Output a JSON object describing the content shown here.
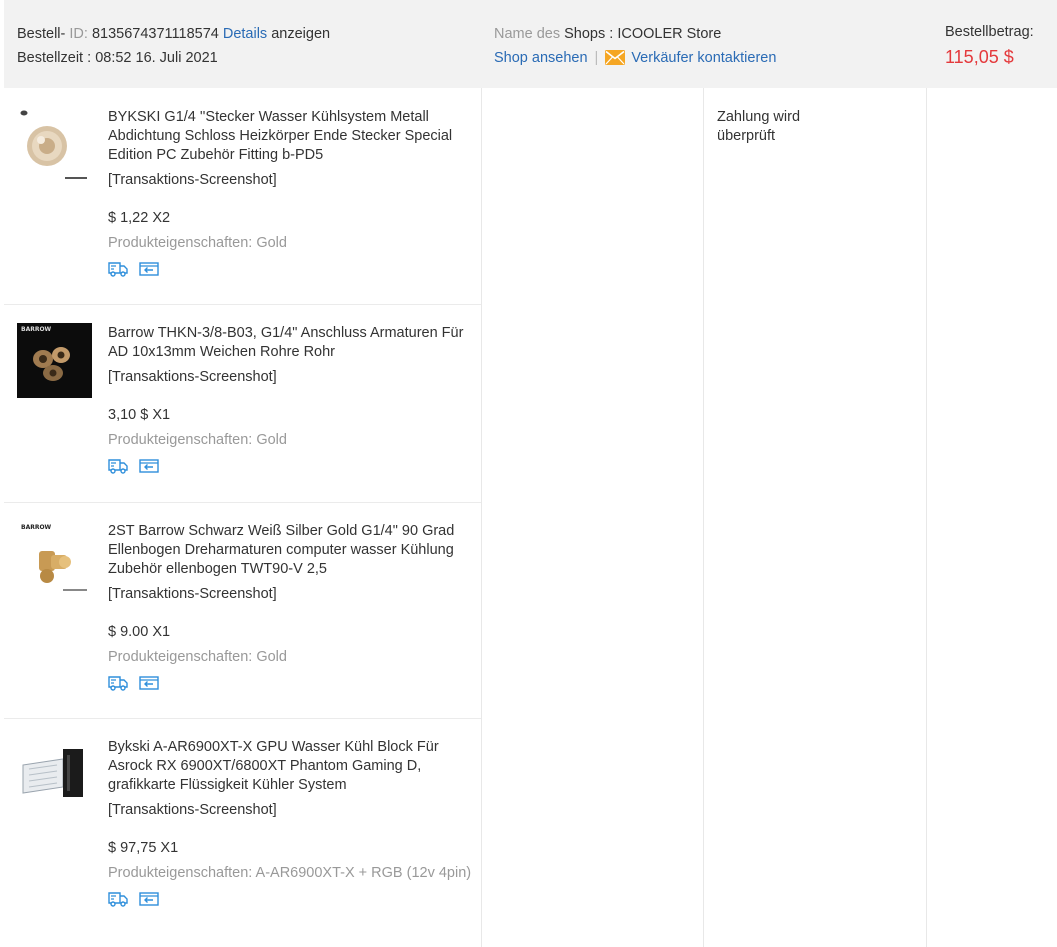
{
  "order": {
    "id_prefix": "Bestell-",
    "id_label": "ID:",
    "id_value": "8135674371118574",
    "details_link": "Details",
    "details_suffix": "anzeigen",
    "time_label": "Bestellzeit :",
    "time_value": "08:52 16. Juli 2021"
  },
  "shop": {
    "name_label_muted": "Name des",
    "name_label": "Shops :",
    "name_value": "ICOOLER Store",
    "view_link": "Shop ansehen",
    "separator": "|",
    "contact_link": "Verkäufer kontaktieren"
  },
  "total": {
    "label": "Bestellbetrag:",
    "value": "115,05 $"
  },
  "status": {
    "line1": "Zahlung wird",
    "line2": "überprüft"
  },
  "colors": {
    "link": "#2a6bb5",
    "price_accent": "#e4393c",
    "header_bg": "#f2f2f2",
    "icon_blue": "#2f8fdb",
    "mail_orange": "#f5a623"
  },
  "items": [
    {
      "title": "BYKSKI G1/4 ''Stecker Wasser Kühlsystem Metall Abdichtung Schloss Heizkörper Ende Stecker Special Edition PC Zubehör Fitting b-PD5",
      "snapshot": "[Transaktions-Screenshot]",
      "price": "$ 1,22 X2",
      "props": "Produkteigenschaften: Gold"
    },
    {
      "title": "Barrow THKN-3/8-B03, G1/4\" Anschluss Armaturen Für AD 10x13mm Weichen Rohre Rohr",
      "snapshot": "[Transaktions-Screenshot]",
      "price": "3,10 $ X1",
      "props": "Produkteigenschaften: Gold",
      "thumb_label": "BARROW"
    },
    {
      "title": "2ST Barrow Schwarz Weiß Silber Gold G1/4\" 90 Grad Ellenbogen Dreharmaturen computer wasser Kühlung Zubehör ellenbogen TWT90-V 2,5",
      "snapshot": "[Transaktions-Screenshot]",
      "price": "$ 9.00 X1",
      "props": "Produkteigenschaften: Gold",
      "thumb_label": "BARROW"
    },
    {
      "title": "Bykski A-AR6900XT-X GPU Wasser Kühl Block Für Asrock RX 6900XT/6800XT Phantom Gaming D, grafikkarte Flüssigkeit Kühler System",
      "snapshot": "[Transaktions-Screenshot]",
      "price": "$ 97,75 X1",
      "props": "Produkteigenschaften: A-AR6900XT-X + RGB (12v 4pin)"
    }
  ]
}
